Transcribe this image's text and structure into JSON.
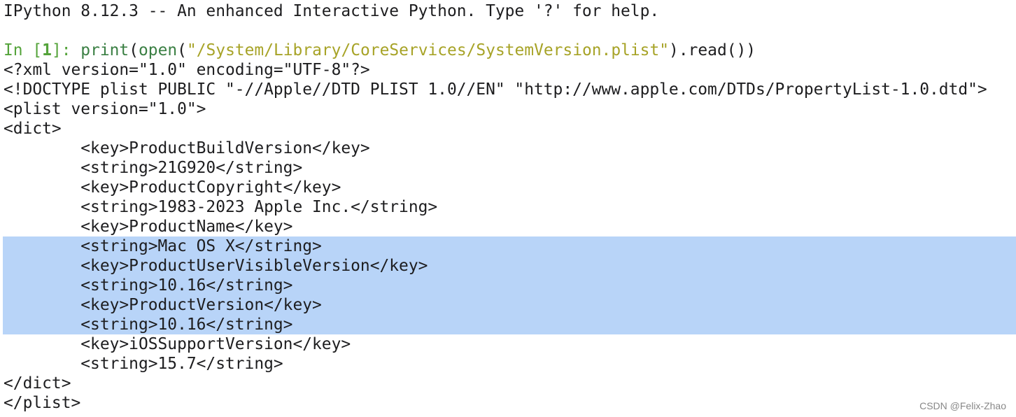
{
  "banner": "IPython 8.12.3 -- An enhanced Interactive Python. Type '?' for help.",
  "prompt": {
    "in_label": "In [",
    "number": "1",
    "close": "]: ",
    "code_print": "print",
    "code_paren_open": "(",
    "code_open": "open",
    "code_paren2": "(",
    "code_string": "\"/System/Library/CoreServices/SystemVersion.plist\"",
    "code_tail": ").read())"
  },
  "output_lines": [
    "<?xml version=\"1.0\" encoding=\"UTF-8\"?>",
    "<!DOCTYPE plist PUBLIC \"-//Apple//DTD PLIST 1.0//EN\" \"http://www.apple.com/DTDs/PropertyList-1.0.dtd\">",
    "<plist version=\"1.0\">",
    "<dict>",
    "        <key>ProductBuildVersion</key>",
    "        <string>21G920</string>",
    "        <key>ProductCopyright</key>",
    "        <string>1983-2023 Apple Inc.</string>",
    "        <key>ProductName</key>",
    "        <string>Mac OS X</string>",
    "        <key>ProductUserVisibleVersion</key>",
    "        <string>10.16</string>",
    "        <key>ProductVersion</key>",
    "        <string>10.16</string>",
    "        <key>iOSSupportVersion</key>",
    "        <string>15.7</string>",
    "</dict>",
    "</plist>"
  ],
  "watermark": "CSDN @Felix-Zhao",
  "colors": {
    "selection": "#b8d4f8",
    "prompt": "#54a33a",
    "string_literal": "#a7a327",
    "text": "#1d1d1f"
  }
}
